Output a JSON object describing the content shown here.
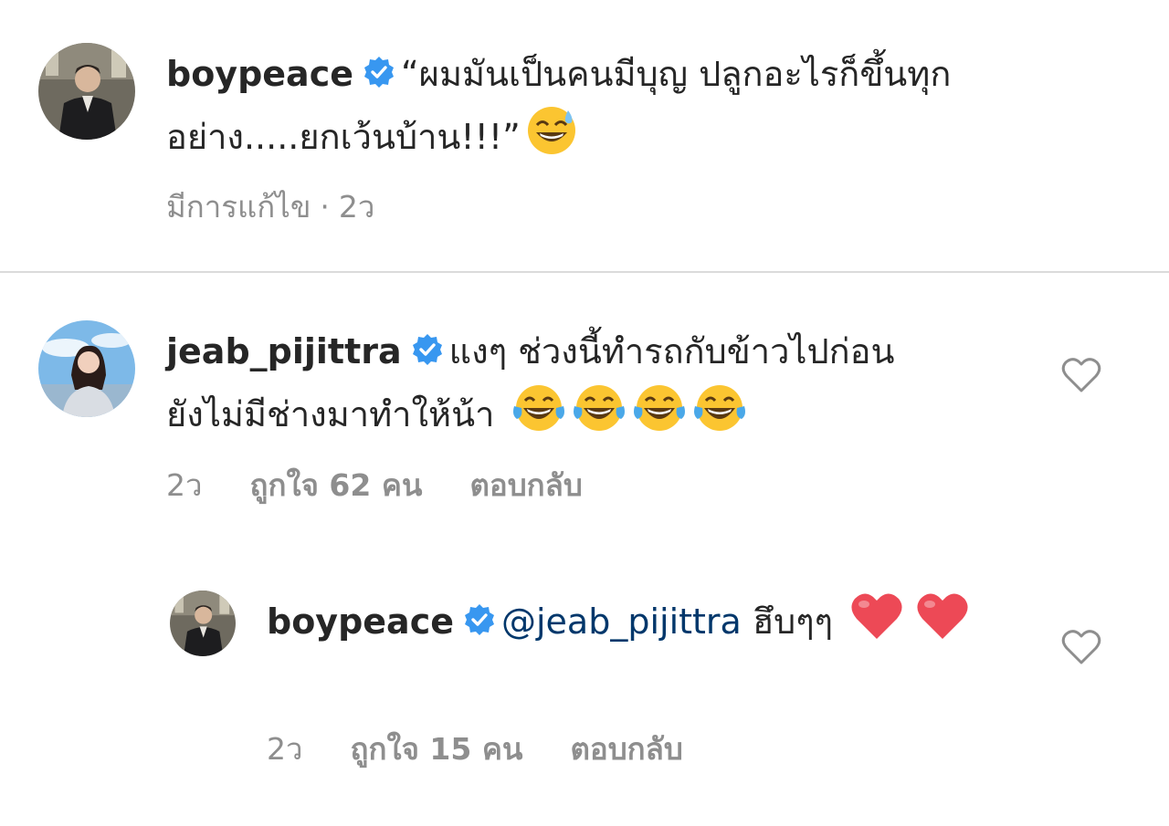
{
  "caption": {
    "username": "boypeace",
    "text": "“ผมมันเป็นคนมีบุญ ปลูกอะไรก็ขึ้นทุกอย่าง.....ยกเว้นบ้าน!!!”",
    "emoji": "sweat-smile",
    "edited_label": "มีการแก้ไข",
    "separator": "·",
    "time": "2ว"
  },
  "comments": [
    {
      "username": "jeab_pijittra",
      "text": "แงๆ  ช่วงนี้ทำรถกับข้าวไปก่อน ยังไม่มีช่างมาทำให้น้า",
      "emoji_count": 4,
      "time": "2ว",
      "likes": "ถูกใจ 62 คน",
      "reply": "ตอบกลับ"
    },
    {
      "username": "boypeace",
      "mention": "@jeab_pijittra",
      "text": "ฮึบๆๆ",
      "time": "2ว",
      "likes": "ถูกใจ 15 คน",
      "reply": "ตอบกลับ"
    }
  ],
  "colors": {
    "verified": "#3897f0",
    "mention": "#00376b",
    "meta": "#8e8e8e",
    "heart_red": "#ed4956"
  },
  "icons": {
    "verified": "verified-badge-icon",
    "like": "heart-outline-icon",
    "laugh": "face-with-tears-of-joy-icon",
    "red_heart": "red-heart-icon"
  }
}
